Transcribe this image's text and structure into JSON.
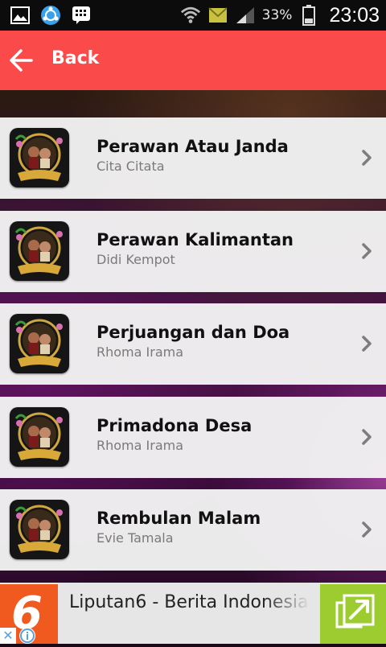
{
  "status_bar": {
    "battery_percent": "33%",
    "time": "23:03",
    "icons": [
      "gallery-icon",
      "sync-icon",
      "bbm-icon",
      "wifi-icon",
      "message-icon",
      "signal-icon",
      "battery-icon"
    ]
  },
  "header": {
    "back_label": "Back",
    "color": "#fb4a4a"
  },
  "songs": [
    {
      "title": "Perawan Atau Janda",
      "artist": "Cita Citata"
    },
    {
      "title": "Perawan Kalimantan",
      "artist": "Didi Kempot"
    },
    {
      "title": "Perjuangan dan Doa",
      "artist": "Rhoma Irama"
    },
    {
      "title": "Primadona Desa",
      "artist": "Rhoma Irama"
    },
    {
      "title": "Rembulan Malam",
      "artist": "Evie Tamala"
    }
  ],
  "ad": {
    "logo_text": "6",
    "text": "Liputan6 - Berita Indonesia",
    "cta_icon": "open-external-icon",
    "brand_color": "#f05a1e",
    "cta_color": "#9ccc2f"
  }
}
